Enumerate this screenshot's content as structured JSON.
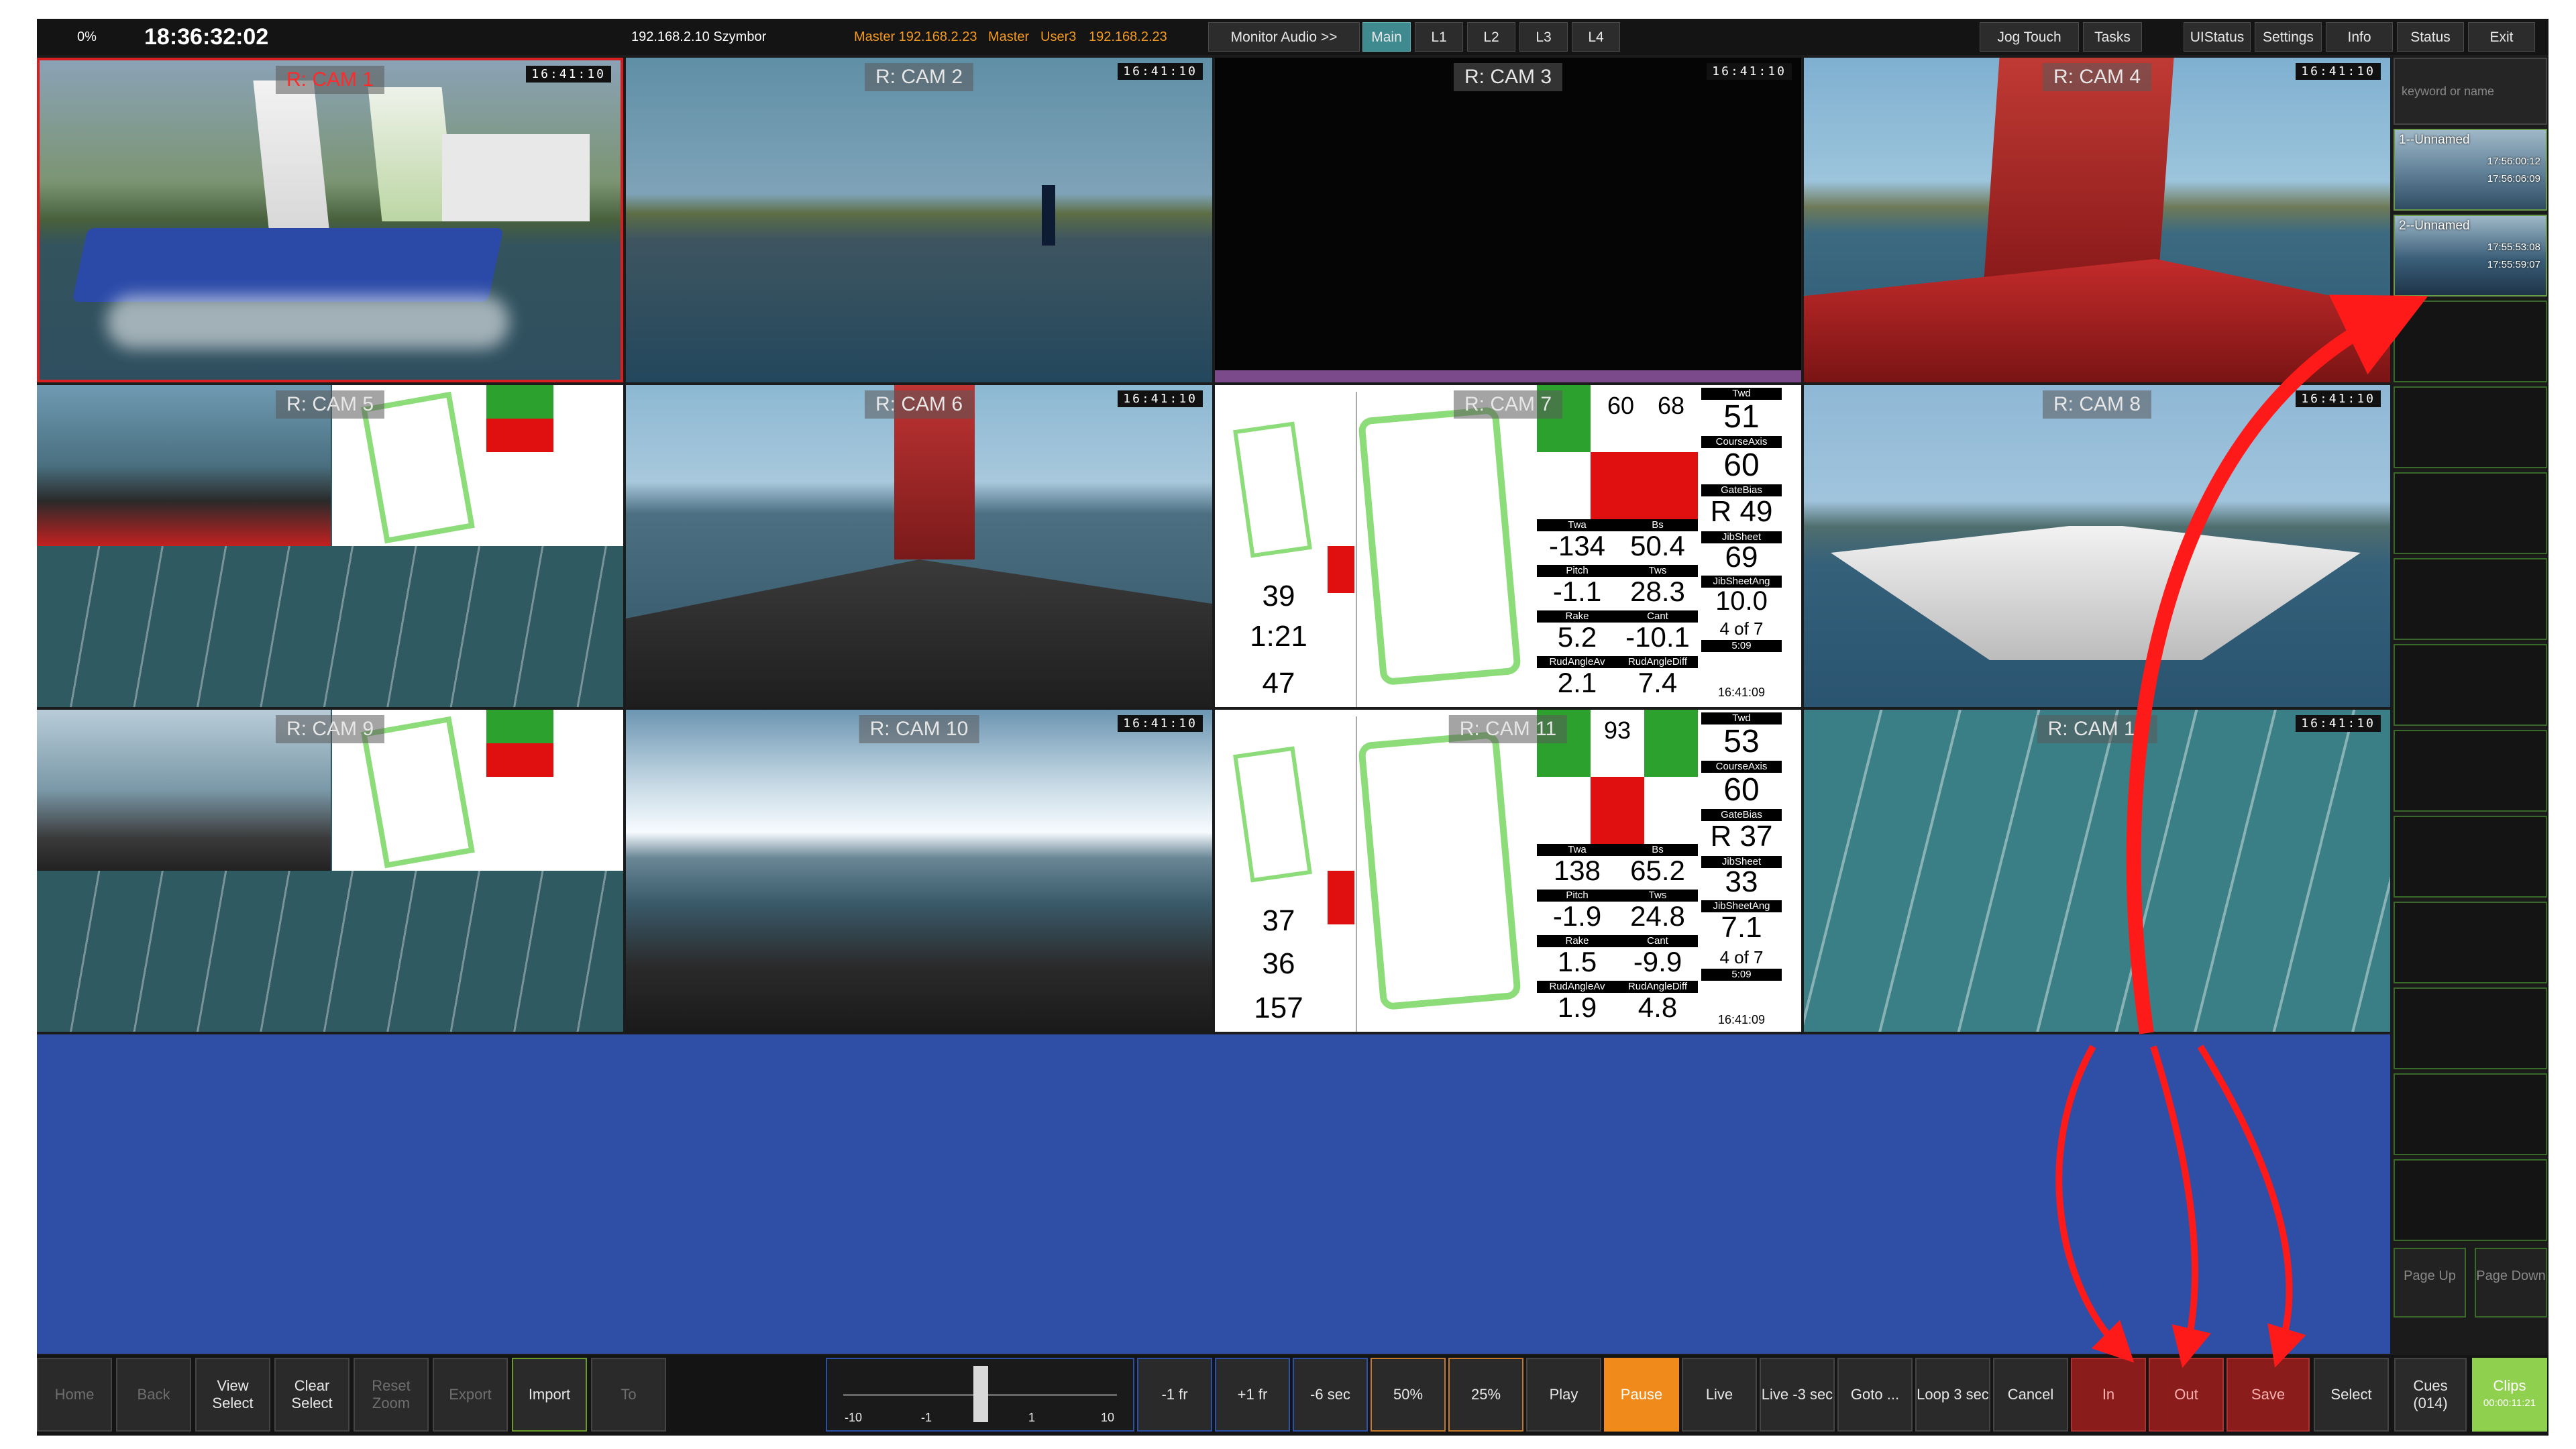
{
  "topbar": {
    "progress": "0%",
    "clock": "18:36:32:02",
    "host": "192.168.2.10 Szymbor",
    "master_label_1": "Master 192.168.2.23",
    "master_label_2": "Master",
    "user_label": "User3",
    "master_ip": "192.168.2.23",
    "monitor_audio": "Monitor Audio >>",
    "main": "Main",
    "l1": "L1",
    "l2": "L2",
    "l3": "L3",
    "l4": "L4",
    "jog_touch": "Jog Touch",
    "tasks": "Tasks",
    "ui_status": "UIStatus",
    "settings": "Settings",
    "info": "Info",
    "status": "Status",
    "exit": "Exit"
  },
  "cams": [
    {
      "label": "R: CAM 1",
      "tc": "16:41:10"
    },
    {
      "label": "R: CAM 2",
      "tc": "16:41:10"
    },
    {
      "label": "R: CAM 3",
      "tc": "16:41:10"
    },
    {
      "label": "R: CAM 4",
      "tc": "16:41:10"
    },
    {
      "label": "R: CAM 5",
      "tc": "16:41:10"
    },
    {
      "label": "R: CAM 6",
      "tc": "16:41:10"
    },
    {
      "label": "R: CAM 7",
      "tc": "16:41:10"
    },
    {
      "label": "R: CAM 8",
      "tc": "16:41:10"
    },
    {
      "label": "R: CAM 9",
      "tc": "16:41:10"
    },
    {
      "label": "R: CAM 10",
      "tc": "16:41:10"
    },
    {
      "label": "R: CAM 11",
      "tc": "16:41:10"
    },
    {
      "label": "R: CAM 12",
      "tc": "16:41:10"
    }
  ],
  "telemetry_7": {
    "twd_label": "Twd",
    "twd": "51",
    "course_label": "CourseAxis",
    "course": "60",
    "gate_label": "GateBias",
    "gate": "R 49",
    "jib_label": "JibSheet",
    "jib": "69",
    "twa_label": "Twa",
    "twa": "-134",
    "bs_label": "Bs",
    "bs": "50.4",
    "jibang_label": "JibSheetAng",
    "jibang": "10.0",
    "pitch_label": "Pitch",
    "pitch": "-1.1",
    "tws_label": "Tws",
    "tws": "28.3",
    "rake_label": "Rake",
    "rake": "5.2",
    "cant_label": "Cant",
    "cant": "-10.1",
    "rud_label": "RudAngleAv",
    "rud": "2.1",
    "ruddiff_label": "RudAngleDiff",
    "ruddiff": "7.4",
    "lap": "4 of 7",
    "lap_time": "5:09",
    "time": "16:41:09",
    "top_mid": "60",
    "top_right": "68",
    "l1": "39",
    "l2": "1:21",
    "l3": "47"
  },
  "telemetry_11": {
    "twd_label": "Twd",
    "twd": "53",
    "course_label": "CourseAxis",
    "course": "60",
    "gate_label": "GateBias",
    "gate": "R 37",
    "jib_label": "JibSheet",
    "jib": "33",
    "twa_label": "Twa",
    "twa": "138",
    "bs_label": "Bs",
    "bs": "65.2",
    "jibang_label": "JibSheetAng",
    "jibang": "7.1",
    "pitch_label": "Pitch",
    "pitch": "-1.9",
    "tws_label": "Tws",
    "tws": "24.8",
    "rake_label": "Rake",
    "rake": "1.5",
    "cant_label": "Cant",
    "cant": "-9.9",
    "rud_label": "RudAngleAv",
    "rud": "1.9",
    "ruddiff_label": "RudAngleDiff",
    "ruddiff": "4.8",
    "lap": "4 of 7",
    "lap_time": "5:09",
    "time": "16:41:09",
    "top_mid": "93",
    "l1": "37",
    "l2": "36",
    "l3": "157"
  },
  "clips": {
    "search_placeholder": "keyword or name",
    "items": [
      {
        "name": "1--Unnamed",
        "in": "17:56:00:12",
        "out": "17:56:06:09"
      },
      {
        "name": "2--Unnamed",
        "in": "17:55:53:08",
        "out": "17:55:59:07"
      }
    ],
    "page_up": "Page Up",
    "page_down": "Page Down"
  },
  "bottombar": {
    "home": "Home",
    "back": "Back",
    "view_select": "View Select",
    "clear_select": "Clear Select",
    "reset_zoom": "Reset Zoom",
    "export": "Export",
    "import": "Import",
    "to": "To",
    "jog_labels": [
      "-10",
      "-1",
      "1",
      "10"
    ],
    "minus_1fr": "-1 fr",
    "plus_1fr": "+1 fr",
    "minus_6sec": "-6 sec",
    "p50": "50%",
    "p25": "25%",
    "play": "Play",
    "pause": "Pause",
    "live": "Live",
    "live_3sec": "Live -3 sec",
    "goto": "Goto ...",
    "loop": "Loop 3 sec",
    "cancel": "Cancel",
    "in": "In",
    "out": "Out",
    "save": "Save",
    "select": "Select",
    "cues": "Cues (014)",
    "clips": "Clips",
    "clips_time": "00:00:11:21"
  },
  "colors": {
    "accent_teal": "#3f8a8e",
    "preview_blue": "#2f4ea6",
    "pause_orange": "#f08a1a",
    "clips_green": "#8fd14f",
    "record_red": "#8a1c1c",
    "annotation_red": "#ff1a1a"
  }
}
